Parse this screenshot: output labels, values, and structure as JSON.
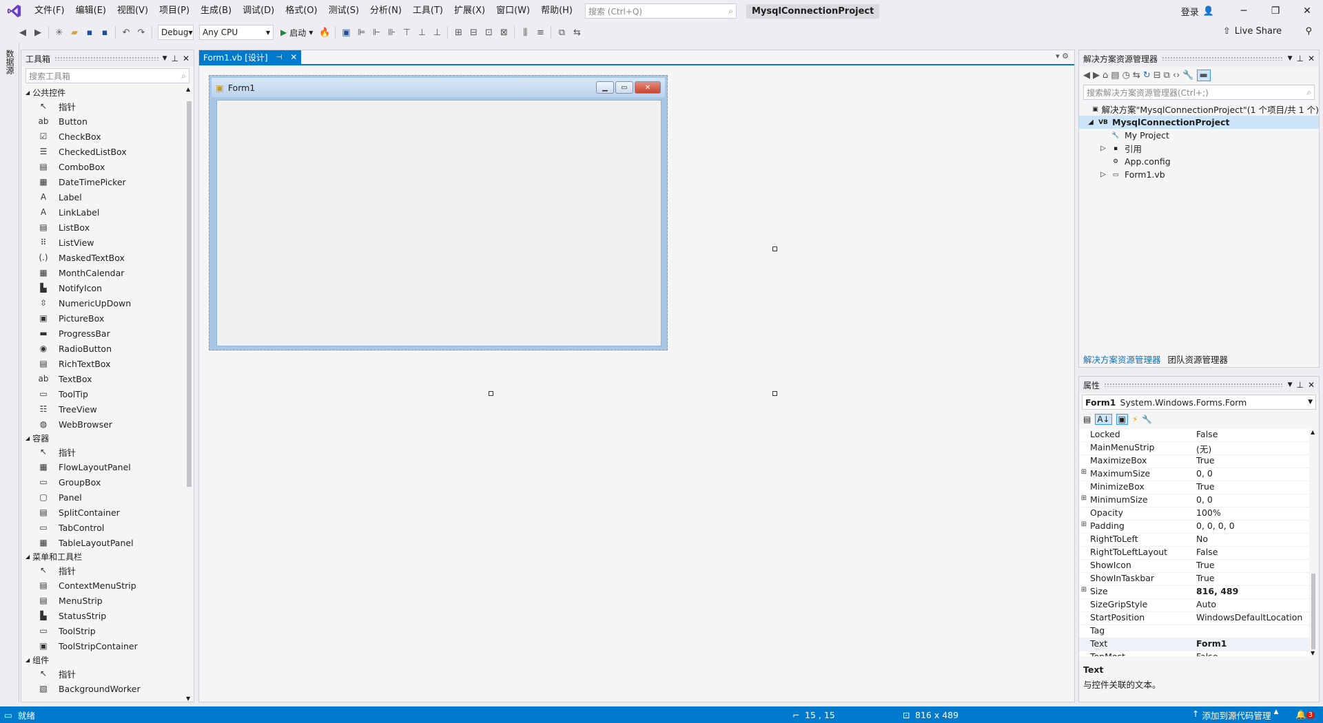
{
  "menu": {
    "items": [
      "文件(F)",
      "编辑(E)",
      "视图(V)",
      "项目(P)",
      "生成(B)",
      "调试(D)",
      "格式(O)",
      "测试(S)",
      "分析(N)",
      "工具(T)",
      "扩展(X)",
      "窗口(W)",
      "帮助(H)"
    ],
    "search_placeholder": "搜索 (Ctrl+Q)",
    "project_title": "MysqlConnectionProject",
    "login_label": "登录"
  },
  "toolbar": {
    "config": "Debug",
    "platform": "Any CPU",
    "start_label": "启动",
    "live_share": "Live Share"
  },
  "left_strip": {
    "label": "数据源"
  },
  "toolbox": {
    "title": "工具箱",
    "search_placeholder": "搜索工具箱",
    "categories": [
      {
        "name": "公共控件",
        "items": [
          {
            "icon": "pointer-icon",
            "glyph": "↖",
            "label": "指针"
          },
          {
            "icon": "button-icon",
            "glyph": "ab",
            "label": "Button"
          },
          {
            "icon": "checkbox-icon",
            "glyph": "☑",
            "label": "CheckBox"
          },
          {
            "icon": "checkedlistbox-icon",
            "glyph": "☰",
            "label": "CheckedListBox"
          },
          {
            "icon": "combobox-icon",
            "glyph": "▤",
            "label": "ComboBox"
          },
          {
            "icon": "datetimepicker-icon",
            "glyph": "▦",
            "label": "DateTimePicker"
          },
          {
            "icon": "label-icon",
            "glyph": "A",
            "label": "Label"
          },
          {
            "icon": "linklabel-icon",
            "glyph": "A",
            "label": "LinkLabel"
          },
          {
            "icon": "listbox-icon",
            "glyph": "▤",
            "label": "ListBox"
          },
          {
            "icon": "listview-icon",
            "glyph": "⠿",
            "label": "ListView"
          },
          {
            "icon": "maskedtextbox-icon",
            "glyph": "(.)",
            "label": "MaskedTextBox"
          },
          {
            "icon": "monthcalendar-icon",
            "glyph": "▦",
            "label": "MonthCalendar"
          },
          {
            "icon": "notifyicon-icon",
            "glyph": "▙",
            "label": "NotifyIcon"
          },
          {
            "icon": "numericupdown-icon",
            "glyph": "⇳",
            "label": "NumericUpDown"
          },
          {
            "icon": "picturebox-icon",
            "glyph": "▣",
            "label": "PictureBox"
          },
          {
            "icon": "progressbar-icon",
            "glyph": "▬",
            "label": "ProgressBar"
          },
          {
            "icon": "radiobutton-icon",
            "glyph": "◉",
            "label": "RadioButton"
          },
          {
            "icon": "richtextbox-icon",
            "glyph": "▤",
            "label": "RichTextBox"
          },
          {
            "icon": "textbox-icon",
            "glyph": "ab",
            "label": "TextBox"
          },
          {
            "icon": "tooltip-icon",
            "glyph": "▭",
            "label": "ToolTip"
          },
          {
            "icon": "treeview-icon",
            "glyph": "☷",
            "label": "TreeView"
          },
          {
            "icon": "webbrowser-icon",
            "glyph": "◍",
            "label": "WebBrowser"
          }
        ]
      },
      {
        "name": "容器",
        "items": [
          {
            "icon": "pointer-icon",
            "glyph": "↖",
            "label": "指针"
          },
          {
            "icon": "flowlayoutpanel-icon",
            "glyph": "▦",
            "label": "FlowLayoutPanel"
          },
          {
            "icon": "groupbox-icon",
            "glyph": "▭",
            "label": "GroupBox"
          },
          {
            "icon": "panel-icon",
            "glyph": "▢",
            "label": "Panel"
          },
          {
            "icon": "splitcontainer-icon",
            "glyph": "▤",
            "label": "SplitContainer"
          },
          {
            "icon": "tabcontrol-icon",
            "glyph": "▭",
            "label": "TabControl"
          },
          {
            "icon": "tablelayoutpanel-icon",
            "glyph": "▦",
            "label": "TableLayoutPanel"
          }
        ]
      },
      {
        "name": "菜单和工具栏",
        "items": [
          {
            "icon": "pointer-icon",
            "glyph": "↖",
            "label": "指针"
          },
          {
            "icon": "contextmenustrip-icon",
            "glyph": "▤",
            "label": "ContextMenuStrip"
          },
          {
            "icon": "menustrip-icon",
            "glyph": "▤",
            "label": "MenuStrip"
          },
          {
            "icon": "statusstrip-icon",
            "glyph": "▙",
            "label": "StatusStrip"
          },
          {
            "icon": "toolstrip-icon",
            "glyph": "▭",
            "label": "ToolStrip"
          },
          {
            "icon": "toolstripcontainer-icon",
            "glyph": "▣",
            "label": "ToolStripContainer"
          }
        ]
      },
      {
        "name": "组件",
        "items": [
          {
            "icon": "pointer-icon",
            "glyph": "↖",
            "label": "指针"
          },
          {
            "icon": "backgroundworker-icon",
            "glyph": "▧",
            "label": "BackgroundWorker"
          }
        ]
      }
    ]
  },
  "document": {
    "tab_label": "Form1.vb [设计]",
    "form_title": "Form1"
  },
  "solution_explorer": {
    "title": "解决方案资源管理器",
    "search_placeholder": "搜索解决方案资源管理器(Ctrl+;)",
    "nodes": [
      {
        "indent": 0,
        "toggle": "",
        "icon": "solution-icon",
        "glyph": "▣",
        "label": "解决方案\"MysqlConnectionProject\"(1 个项目/共 1 个)",
        "bold": false,
        "selected": false
      },
      {
        "indent": 0,
        "toggle": "◢",
        "icon": "vb-project-icon",
        "glyph": "VB",
        "label": "MysqlConnectionProject",
        "bold": true,
        "selected": true
      },
      {
        "indent": 1,
        "toggle": "",
        "icon": "wrench-icon",
        "glyph": "🔧",
        "label": "My Project",
        "bold": false,
        "selected": false
      },
      {
        "indent": 1,
        "toggle": "▷",
        "icon": "references-icon",
        "glyph": "▪",
        "label": "引用",
        "bold": false,
        "selected": false
      },
      {
        "indent": 1,
        "toggle": "",
        "icon": "config-file-icon",
        "glyph": "⚙",
        "label": "App.config",
        "bold": false,
        "selected": false
      },
      {
        "indent": 1,
        "toggle": "▷",
        "icon": "form-file-icon",
        "glyph": "▭",
        "label": "Form1.vb",
        "bold": false,
        "selected": false
      }
    ],
    "tab_active": "解决方案资源管理器",
    "tab_other": "团队资源管理器"
  },
  "properties": {
    "title": "属性",
    "object_name": "Form1",
    "object_type": "System.Windows.Forms.Form",
    "rows": [
      {
        "name": "Locked",
        "value": "False",
        "expand": "",
        "bold": false
      },
      {
        "name": "MainMenuStrip",
        "value": "(无)",
        "expand": "",
        "bold": false
      },
      {
        "name": "MaximizeBox",
        "value": "True",
        "expand": "",
        "bold": false
      },
      {
        "name": "MaximumSize",
        "value": "0, 0",
        "expand": "⊞",
        "bold": false
      },
      {
        "name": "MinimizeBox",
        "value": "True",
        "expand": "",
        "bold": false
      },
      {
        "name": "MinimumSize",
        "value": "0, 0",
        "expand": "⊞",
        "bold": false
      },
      {
        "name": "Opacity",
        "value": "100%",
        "expand": "",
        "bold": false
      },
      {
        "name": "Padding",
        "value": "0, 0, 0, 0",
        "expand": "⊞",
        "bold": false
      },
      {
        "name": "RightToLeft",
        "value": "No",
        "expand": "",
        "bold": false
      },
      {
        "name": "RightToLeftLayout",
        "value": "False",
        "expand": "",
        "bold": false
      },
      {
        "name": "ShowIcon",
        "value": "True",
        "expand": "",
        "bold": false
      },
      {
        "name": "ShowInTaskbar",
        "value": "True",
        "expand": "",
        "bold": false
      },
      {
        "name": "Size",
        "value": "816, 489",
        "expand": "⊞",
        "bold": true
      },
      {
        "name": "SizeGripStyle",
        "value": "Auto",
        "expand": "",
        "bold": false
      },
      {
        "name": "StartPosition",
        "value": "WindowsDefaultLocation",
        "expand": "",
        "bold": false
      },
      {
        "name": "Tag",
        "value": "",
        "expand": "",
        "bold": false
      },
      {
        "name": "Text",
        "value": "Form1",
        "expand": "",
        "bold": true
      },
      {
        "name": "TopMost",
        "value": "False",
        "expand": "",
        "bold": false
      }
    ],
    "desc_title": "Text",
    "desc_text": "与控件关联的文本。"
  },
  "statusbar": {
    "status": "就绪",
    "position": "15 , 15",
    "size": "816 x 489",
    "source_control": "添加到源代码管理",
    "notification_count": "3"
  },
  "colors": {
    "accent": "#007acc",
    "background": "#eeeef2",
    "panel": "#f5f5f5"
  }
}
